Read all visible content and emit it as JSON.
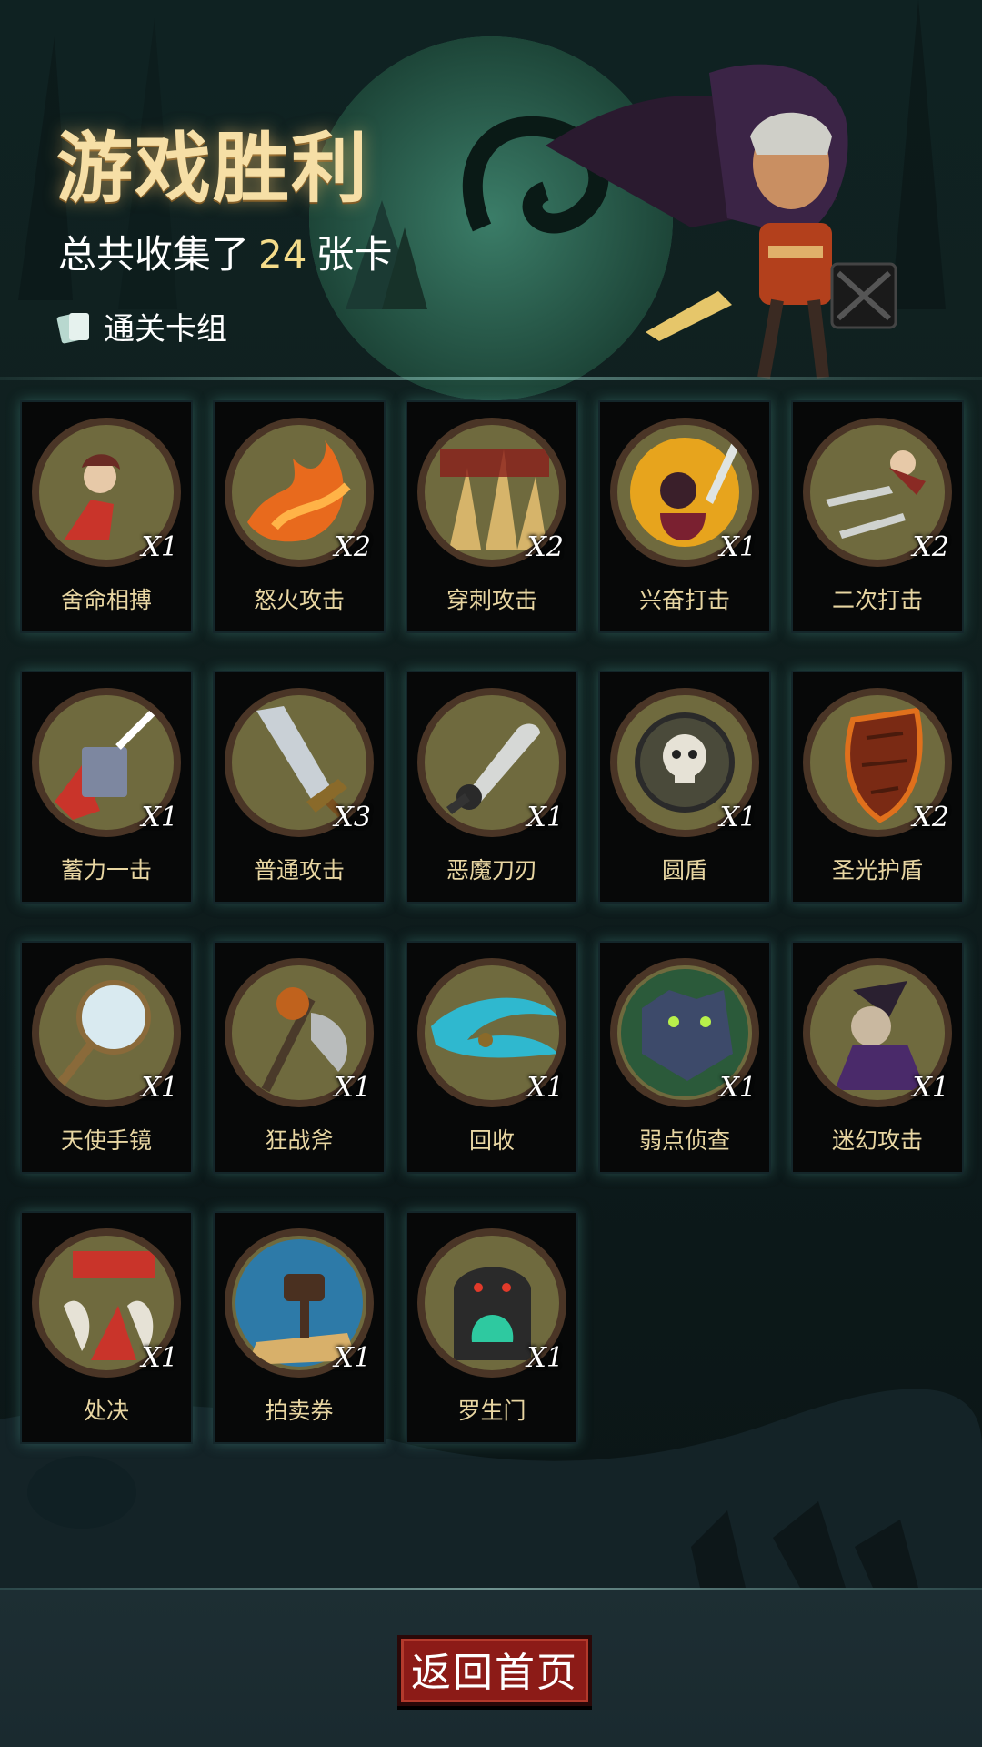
{
  "header": {
    "title": "游戏胜利",
    "subtitle_prefix": "总共收集了",
    "card_count": "24",
    "subtitle_suffix": "张卡",
    "deck_label": "通关卡组"
  },
  "cards": [
    {
      "name": "舍命相搏",
      "qty": "X1",
      "icon": "hooded-girl-strike-icon"
    },
    {
      "name": "怒火攻击",
      "qty": "X2",
      "icon": "fire-slash-icon"
    },
    {
      "name": "穿刺攻击",
      "qty": "X2",
      "icon": "spikes-icon"
    },
    {
      "name": "兴奋打击",
      "qty": "X1",
      "icon": "flaming-hero-sword-icon"
    },
    {
      "name": "二次打击",
      "qty": "X2",
      "icon": "twin-daggers-icon"
    },
    {
      "name": "蓄力一击",
      "qty": "X1",
      "icon": "hammer-smash-icon"
    },
    {
      "name": "普通攻击",
      "qty": "X3",
      "icon": "broadsword-icon"
    },
    {
      "name": "恶魔刀刃",
      "qty": "X1",
      "icon": "demon-blade-icon"
    },
    {
      "name": "圆盾",
      "qty": "X1",
      "icon": "skull-round-shield-icon"
    },
    {
      "name": "圣光护盾",
      "qty": "X2",
      "icon": "wooden-shield-icon"
    },
    {
      "name": "天使手镜",
      "qty": "X1",
      "icon": "hand-mirror-icon"
    },
    {
      "name": "狂战斧",
      "qty": "X1",
      "icon": "pumpkin-axe-icon"
    },
    {
      "name": "回收",
      "qty": "X1",
      "icon": "blue-whirl-icon"
    },
    {
      "name": "弱点侦查",
      "qty": "X1",
      "icon": "wolf-eyes-icon"
    },
    {
      "name": "迷幻攻击",
      "qty": "X1",
      "icon": "witch-icon"
    },
    {
      "name": "处决",
      "qty": "X1",
      "icon": "execution-icon"
    },
    {
      "name": "拍卖券",
      "qty": "X1",
      "icon": "auction-gavel-icon"
    },
    {
      "name": "罗生门",
      "qty": "X1",
      "icon": "demon-gate-icon"
    }
  ],
  "footer": {
    "home_button": "返回首页"
  },
  "colors": {
    "medallion": "#6f6a3e",
    "medallion_rim": "#4a3526",
    "card_name": "#e8d6a2",
    "button": "#8c1b17"
  }
}
